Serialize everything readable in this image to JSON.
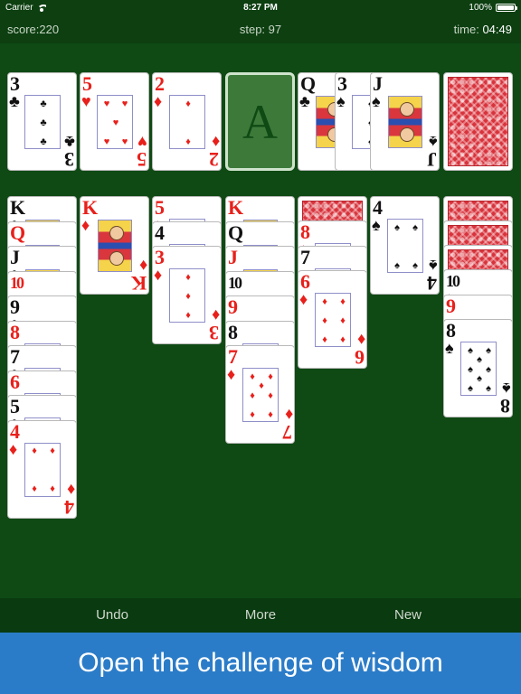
{
  "status": {
    "carrier": "Carrier",
    "time": "8:27 PM",
    "battery": "100%",
    "battery_level": 1.0
  },
  "info": {
    "score_label": "score:",
    "score": "220",
    "step_label": "step:",
    "step": "97",
    "time_label": "time:",
    "time": "04:49"
  },
  "foundation_slot_label": "A",
  "top_row": [
    {
      "rank": "3",
      "suit": "♣",
      "color": "black"
    },
    {
      "rank": "5",
      "suit": "♥",
      "color": "red"
    },
    {
      "rank": "2",
      "suit": "♦",
      "color": "red"
    }
  ],
  "waste": [
    {
      "rank": "Q",
      "suit": "♣",
      "color": "black"
    },
    {
      "rank": "3",
      "suit": "♠",
      "color": "black"
    },
    {
      "rank": "J",
      "suit": "♠",
      "color": "black"
    }
  ],
  "columns": [
    {
      "hidden": 0,
      "cards": [
        {
          "rank": "K",
          "suit": "♣",
          "color": "black"
        },
        {
          "rank": "Q",
          "suit": "♦",
          "color": "red"
        },
        {
          "rank": "J",
          "suit": "♣",
          "color": "black"
        },
        {
          "rank": "10",
          "suit": "♦",
          "color": "red"
        },
        {
          "rank": "9",
          "suit": "♣",
          "color": "black"
        },
        {
          "rank": "8",
          "suit": "♦",
          "color": "red"
        },
        {
          "rank": "7",
          "suit": "♣",
          "color": "black"
        },
        {
          "rank": "6",
          "suit": "♦",
          "color": "red"
        },
        {
          "rank": "5",
          "suit": "♣",
          "color": "black"
        },
        {
          "rank": "4",
          "suit": "♦",
          "color": "red"
        }
      ]
    },
    {
      "hidden": 0,
      "cards": [
        {
          "rank": "K",
          "suit": "♦",
          "color": "red"
        }
      ]
    },
    {
      "hidden": 0,
      "cards": [
        {
          "rank": "5",
          "suit": "♦",
          "color": "red"
        },
        {
          "rank": "4",
          "suit": "♣",
          "color": "black"
        },
        {
          "rank": "3",
          "suit": "♦",
          "color": "red"
        }
      ]
    },
    {
      "hidden": 0,
      "cards": [
        {
          "rank": "K",
          "suit": "♥",
          "color": "red"
        },
        {
          "rank": "Q",
          "suit": "♣",
          "color": "black"
        },
        {
          "rank": "J",
          "suit": "♥",
          "color": "red"
        },
        {
          "rank": "10",
          "suit": "♣",
          "color": "black"
        },
        {
          "rank": "9",
          "suit": "♥",
          "color": "red"
        },
        {
          "rank": "8",
          "suit": "♣",
          "color": "black"
        },
        {
          "rank": "7",
          "suit": "♦",
          "color": "red"
        }
      ]
    },
    {
      "hidden": 1,
      "cards": [
        {
          "rank": "8",
          "suit": "♦",
          "color": "red"
        },
        {
          "rank": "7",
          "suit": "♣",
          "color": "black"
        },
        {
          "rank": "6",
          "suit": "♦",
          "color": "red"
        }
      ]
    },
    {
      "hidden": 0,
      "cards": [
        {
          "rank": "4",
          "suit": "♠",
          "color": "black"
        }
      ]
    },
    {
      "hidden": 3,
      "cards": [
        {
          "rank": "10",
          "suit": "♠",
          "color": "black"
        },
        {
          "rank": "9",
          "suit": "♥",
          "color": "red"
        },
        {
          "rank": "8",
          "suit": "♠",
          "color": "black"
        }
      ]
    }
  ],
  "toolbar": {
    "undo": "Undo",
    "more": "More",
    "new": "New"
  },
  "banner": {
    "text": "Open the challenge of wisdom"
  },
  "colors": {
    "felt": "#0f4a14",
    "bar": "#0d3f11",
    "red_suit": "#e8201b",
    "banner": "#2b7cc8"
  }
}
